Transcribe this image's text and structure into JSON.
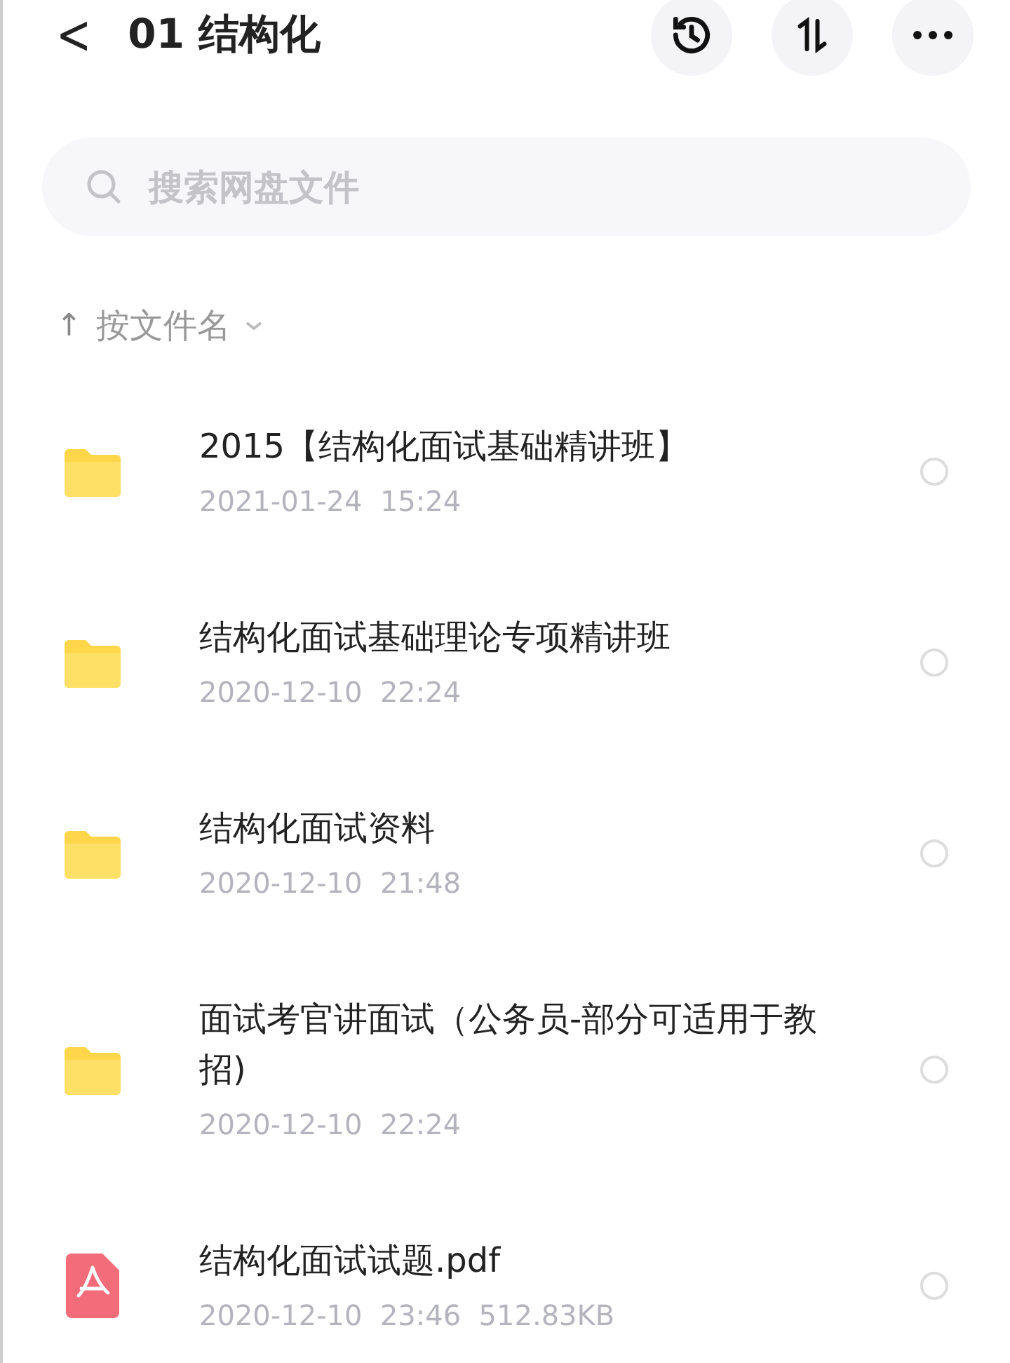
{
  "header": {
    "back": "<",
    "title": "01 结构化"
  },
  "search": {
    "placeholder": "搜索网盘文件"
  },
  "sort": {
    "arrow": "↑",
    "label": "按文件名"
  },
  "items": [
    {
      "kind": "folder",
      "name": "2015【结构化面试基础精讲班】",
      "date": "2021-01-24",
      "time": "15:24",
      "selected": false
    },
    {
      "kind": "folder",
      "name": "结构化面试基础理论专项精讲班",
      "date": "2020-12-10",
      "time": "22:24",
      "selected": false
    },
    {
      "kind": "folder",
      "name": "结构化面试资料",
      "date": "2020-12-10",
      "time": "21:48",
      "selected": false
    },
    {
      "kind": "folder",
      "name": "面试考官讲面试（公务员-部分可适用于教招)",
      "date": "2020-12-10",
      "time": "22:24",
      "selected": false
    },
    {
      "kind": "pdf",
      "name": "结构化面试试题.pdf",
      "date": "2020-12-10",
      "time": "23:46",
      "size": "512.83KB",
      "selected": false
    }
  ]
}
